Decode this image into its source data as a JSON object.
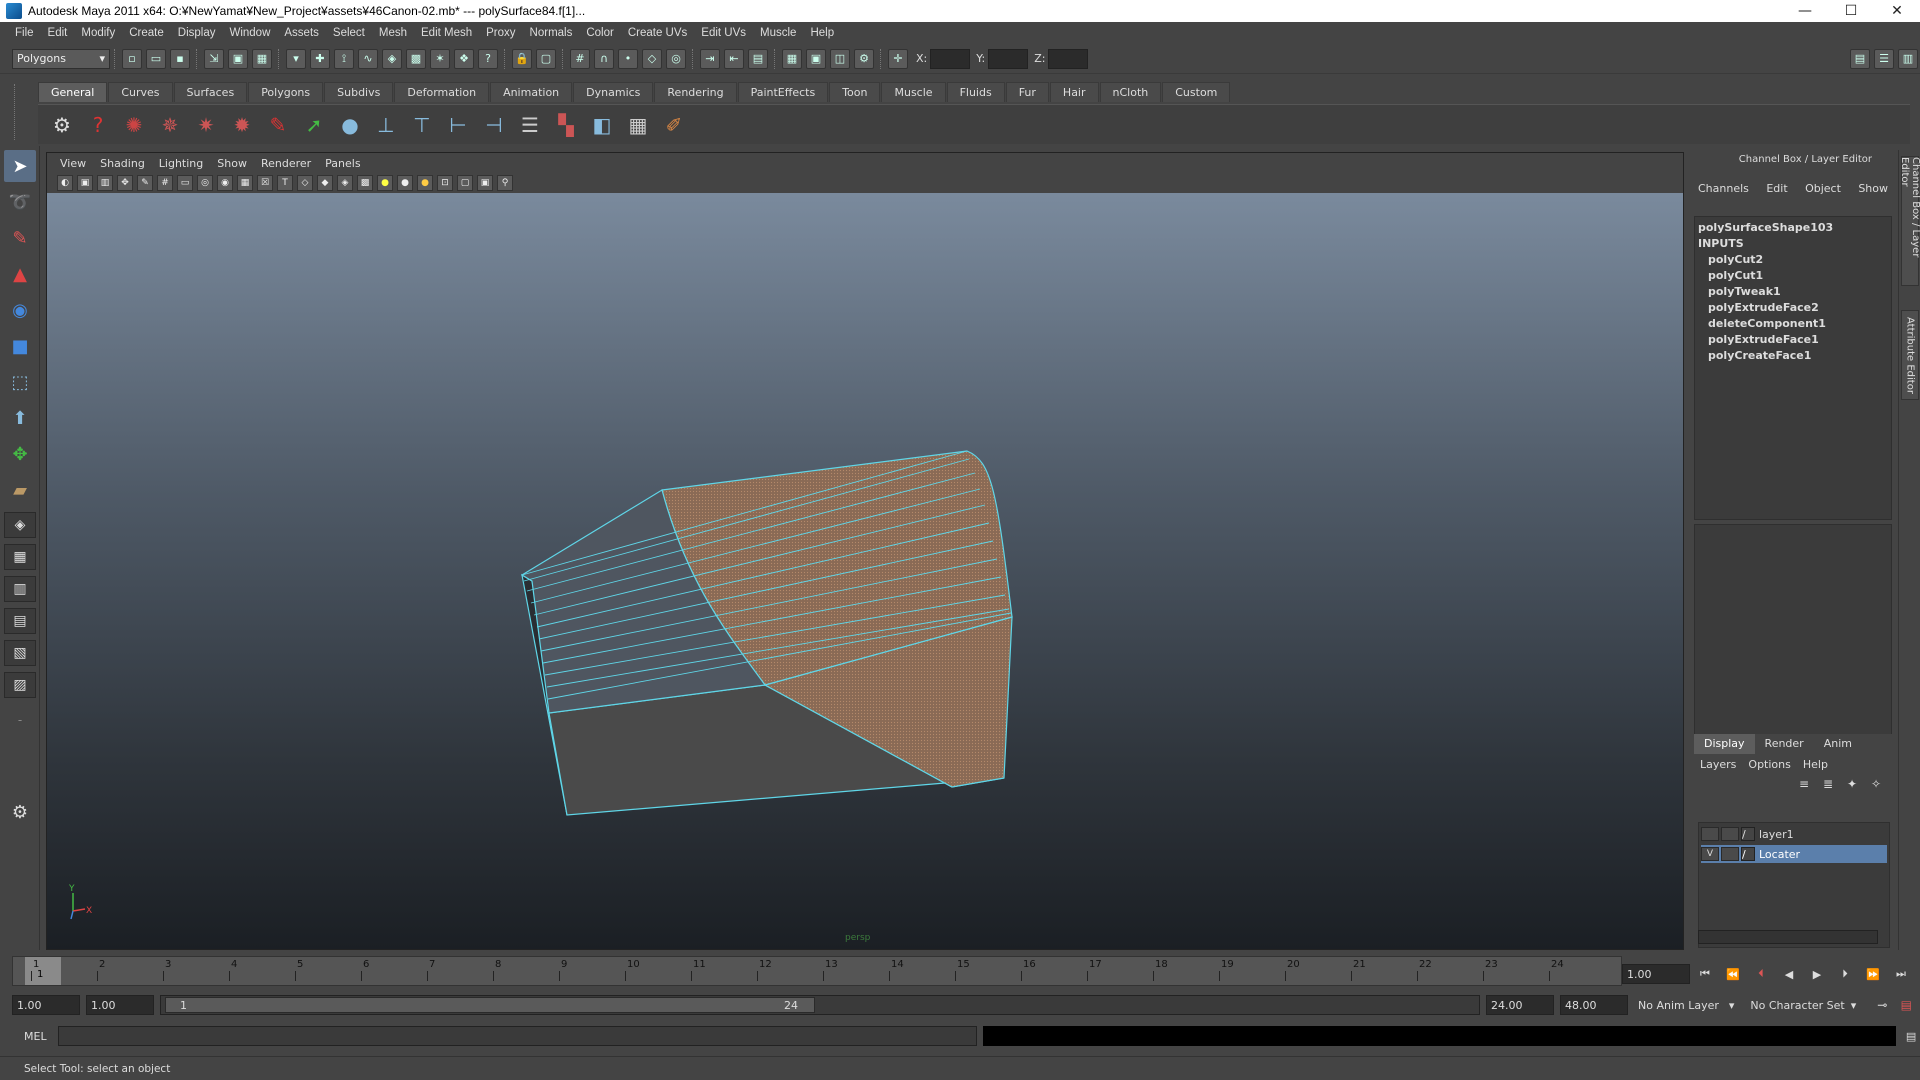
{
  "window": {
    "title": "Autodesk Maya 2011 x64: O:¥NewYamat¥New_Project¥assets¥46Canon-02.mb*  ---   polySurface84.f[1]...",
    "minimize": "—",
    "maximize": "☐",
    "close": "✕"
  },
  "menubar": [
    "File",
    "Edit",
    "Modify",
    "Create",
    "Display",
    "Window",
    "Assets",
    "Select",
    "Mesh",
    "Edit Mesh",
    "Proxy",
    "Normals",
    "Color",
    "Create UVs",
    "Edit UVs",
    "Muscle",
    "Help"
  ],
  "statusline": {
    "mode": "Polygons",
    "x_label": "X:",
    "y_label": "Y:",
    "z_label": "Z:"
  },
  "shelf": {
    "tabs": [
      "General",
      "Curves",
      "Surfaces",
      "Polygons",
      "Subdivs",
      "Deformation",
      "Animation",
      "Dynamics",
      "Rendering",
      "PaintEffects",
      "Toon",
      "Muscle",
      "Fluids",
      "Fur",
      "Hair",
      "nCloth",
      "Custom"
    ],
    "active_tab": "General"
  },
  "viewport": {
    "menu": [
      "View",
      "Shading",
      "Lighting",
      "Show",
      "Renderer",
      "Panels"
    ],
    "camera_label": "persp",
    "colors": {
      "wire": "#5fd6e8",
      "face_selected": "#8a6a55",
      "face_dark": "#4a4a4a"
    }
  },
  "channel_box": {
    "header": "Channel Box / Layer Editor",
    "menu": [
      "Channels",
      "Edit",
      "Object",
      "Show"
    ],
    "shape_name": "polySurfaceShape103",
    "inputs_label": "INPUTS",
    "inputs": [
      "polyCut2",
      "polyCut1",
      "polyTweak1",
      "polyExtrudeFace2",
      "deleteComponent1",
      "polyExtrudeFace1",
      "polyCreateFace1"
    ]
  },
  "layer_editor": {
    "tabs": [
      "Display",
      "Render",
      "Anim"
    ],
    "active_tab": "Display",
    "menu": [
      "Layers",
      "Options",
      "Help"
    ],
    "layers": [
      {
        "name": "layer1",
        "visible": "",
        "selected": false
      },
      {
        "name": "Locater",
        "visible": "V",
        "selected": true
      }
    ]
  },
  "side_tabs": [
    "Channel Box / Layer Editor",
    "Attribute Editor"
  ],
  "timeline": {
    "ticks": [
      "1",
      "2",
      "3",
      "4",
      "5",
      "6",
      "7",
      "8",
      "9",
      "10",
      "11",
      "12",
      "13",
      "14",
      "15",
      "16",
      "17",
      "18",
      "19",
      "20",
      "21",
      "22",
      "23",
      "24"
    ],
    "current_frame_label": "1",
    "current_frame_value": "1.00"
  },
  "range": {
    "start_time": "1.00",
    "playback_start": "1.00",
    "slider_start": "1",
    "slider_end": "24",
    "playback_end": "24.00",
    "end_time": "48.00",
    "anim_layer": "No Anim Layer",
    "character_set": "No Character Set"
  },
  "command_line": {
    "label": "MEL"
  },
  "help_line": "Select Tool: select an object"
}
